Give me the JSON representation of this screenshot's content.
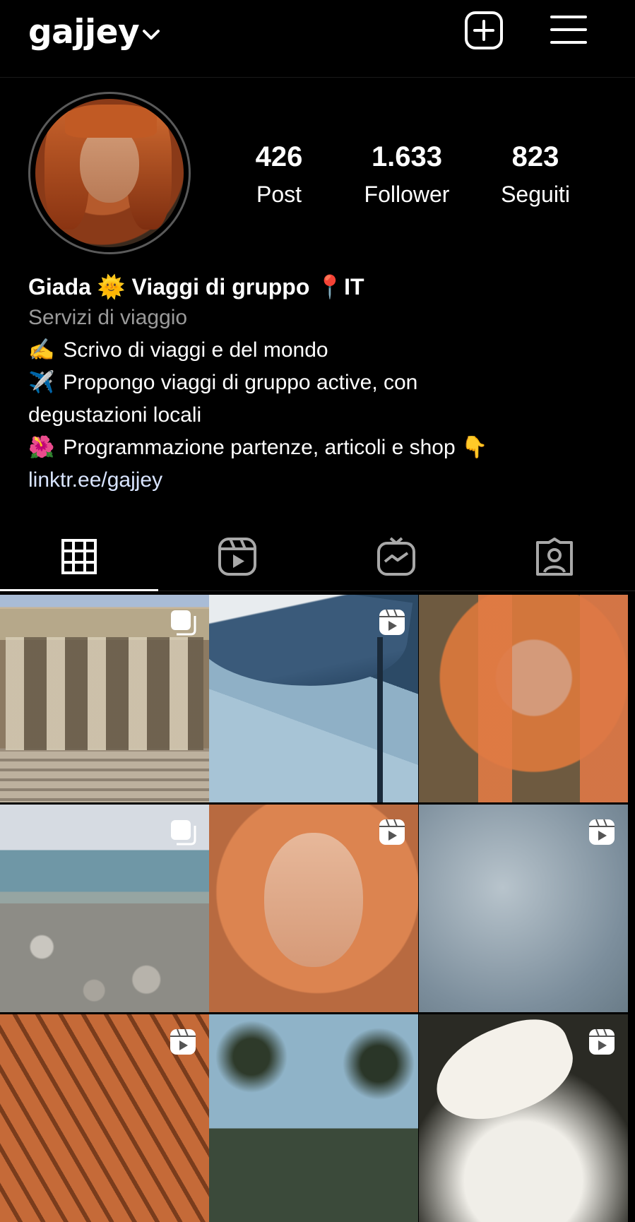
{
  "header": {
    "username": "gajjey",
    "icons": [
      "chevron-down-icon",
      "new-post-icon",
      "menu-icon"
    ]
  },
  "profile": {
    "stats": {
      "posts": {
        "value": "426",
        "label": "Post"
      },
      "followers": {
        "value": "1.633",
        "label": "Follower"
      },
      "following": {
        "value": "823",
        "label": "Seguiti"
      }
    },
    "display_name": "Giada 🌞 Viaggi di gruppo 📍IT",
    "category": "Servizi di viaggio",
    "bio_lines": [
      {
        "emoji": "✍️",
        "text": "Scrivo di viaggi e del mondo"
      },
      {
        "emoji": "✈️",
        "text": "Propongo viaggi di gruppo active, con"
      },
      {
        "emoji": "",
        "text": "degustazioni locali"
      },
      {
        "emoji": "🌺",
        "text": "Programmazione partenze, articoli e shop 👇"
      }
    ],
    "link": "linktr.ee/gajjey"
  },
  "tabs": [
    {
      "name": "grid",
      "icon": "grid-icon",
      "active": true
    },
    {
      "name": "reels",
      "icon": "reels-icon",
      "active": false
    },
    {
      "name": "igtv",
      "icon": "igtv-icon",
      "active": false
    },
    {
      "name": "tagged",
      "icon": "tagged-icon",
      "active": false
    }
  ],
  "grid": [
    {
      "badge": "carousel"
    },
    {
      "badge": "reel"
    },
    {
      "badge": ""
    },
    {
      "badge": "carousel"
    },
    {
      "badge": "reel"
    },
    {
      "badge": "reel"
    },
    {
      "badge": "reel"
    },
    {
      "badge": ""
    },
    {
      "badge": "reel"
    }
  ]
}
